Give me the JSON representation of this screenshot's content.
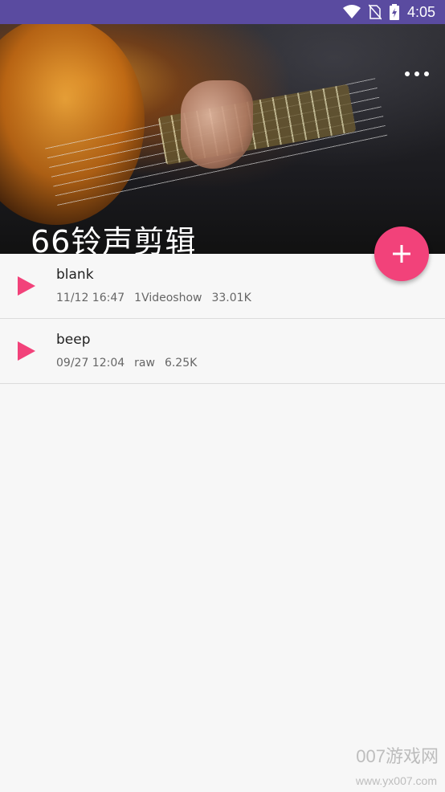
{
  "status_bar": {
    "time": "4:05",
    "icons": [
      "wifi-icon",
      "no-sim-icon",
      "battery-icon"
    ]
  },
  "header": {
    "title": "66铃声剪辑",
    "menu_icon": "more-horiz-icon"
  },
  "fab": {
    "icon": "plus-icon",
    "color": "#f2427a"
  },
  "accent_color": "#f2427a",
  "status_color": "#5a4ba0",
  "list": {
    "items": [
      {
        "name": "blank",
        "date": "11/12 16:47",
        "folder": "1Videoshow",
        "size": "33.01K"
      },
      {
        "name": "beep",
        "date": "09/27 12:04",
        "folder": "raw",
        "size": "6.25K"
      }
    ]
  },
  "watermark": {
    "line1": "007游戏网",
    "line2": "www.yx007.com"
  }
}
